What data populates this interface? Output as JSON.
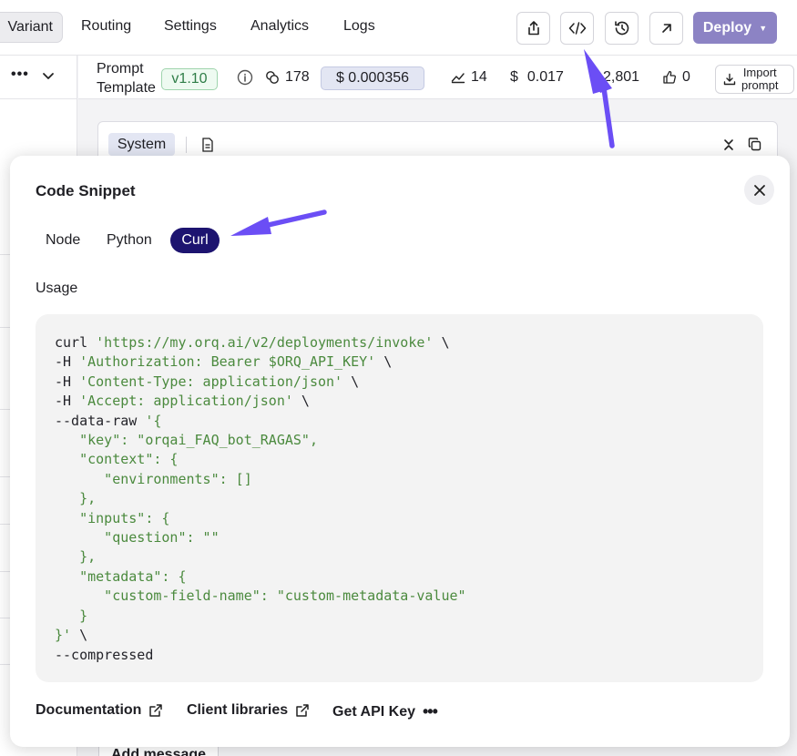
{
  "topnav": {
    "tabs": [
      "Variant",
      "Routing",
      "Settings",
      "Analytics",
      "Logs"
    ],
    "deploy_label": "Deploy"
  },
  "subbar": {
    "prompt_label_line1": "Prompt",
    "prompt_label_line2": "Template",
    "version": "v1.10",
    "tokens": "178",
    "cost": "$ 0.000356",
    "latency": "14",
    "total_cost": "0.017",
    "requests": "2,801",
    "likes": "0",
    "import_line1": "Import",
    "import_line2": "prompt"
  },
  "system_card": {
    "label": "System"
  },
  "add_message_label": "Add message",
  "modal": {
    "title": "Code Snippet",
    "tabs": [
      "Node",
      "Python",
      "Curl"
    ],
    "active_tab": "Curl",
    "usage_label": "Usage",
    "code_lines": [
      [
        {
          "t": "curl "
        },
        {
          "s": "'https://my.orq.ai/v2/deployments/invoke'"
        },
        {
          "t": " \\"
        }
      ],
      [
        {
          "t": "-H "
        },
        {
          "s": "'Authorization: Bearer $ORQ_API_KEY'"
        },
        {
          "t": " \\"
        }
      ],
      [
        {
          "t": "-H "
        },
        {
          "s": "'Content-Type: application/json'"
        },
        {
          "t": " \\"
        }
      ],
      [
        {
          "t": "-H "
        },
        {
          "s": "'Accept: application/json'"
        },
        {
          "t": " \\"
        }
      ],
      [
        {
          "t": "--data-raw "
        },
        {
          "s": "'{"
        }
      ],
      [
        {
          "s": "   \"key\": \"orqai_FAQ_bot_RAGAS\","
        }
      ],
      [
        {
          "s": "   \"context\": {"
        }
      ],
      [
        {
          "s": "      \"environments\": []"
        }
      ],
      [
        {
          "s": "   },"
        }
      ],
      [
        {
          "s": "   \"inputs\": {"
        }
      ],
      [
        {
          "s": "      \"question\": \"\""
        }
      ],
      [
        {
          "s": "   },"
        }
      ],
      [
        {
          "s": "   \"metadata\": {"
        }
      ],
      [
        {
          "s": "      \"custom-field-name\": \"custom-metadata-value\""
        }
      ],
      [
        {
          "s": "   }"
        }
      ],
      [
        {
          "s": "}'"
        },
        {
          "t": " \\"
        }
      ],
      [
        {
          "t": "--compressed"
        }
      ]
    ],
    "footer": {
      "documentation": "Documentation",
      "client_libraries": "Client libraries",
      "get_api_key": "Get API Key"
    }
  },
  "colors": {
    "accent": "#1d1470",
    "annotation_arrow": "#6b4ef5",
    "deploy": "#8c83c4",
    "code_string": "#4b8a3e"
  }
}
